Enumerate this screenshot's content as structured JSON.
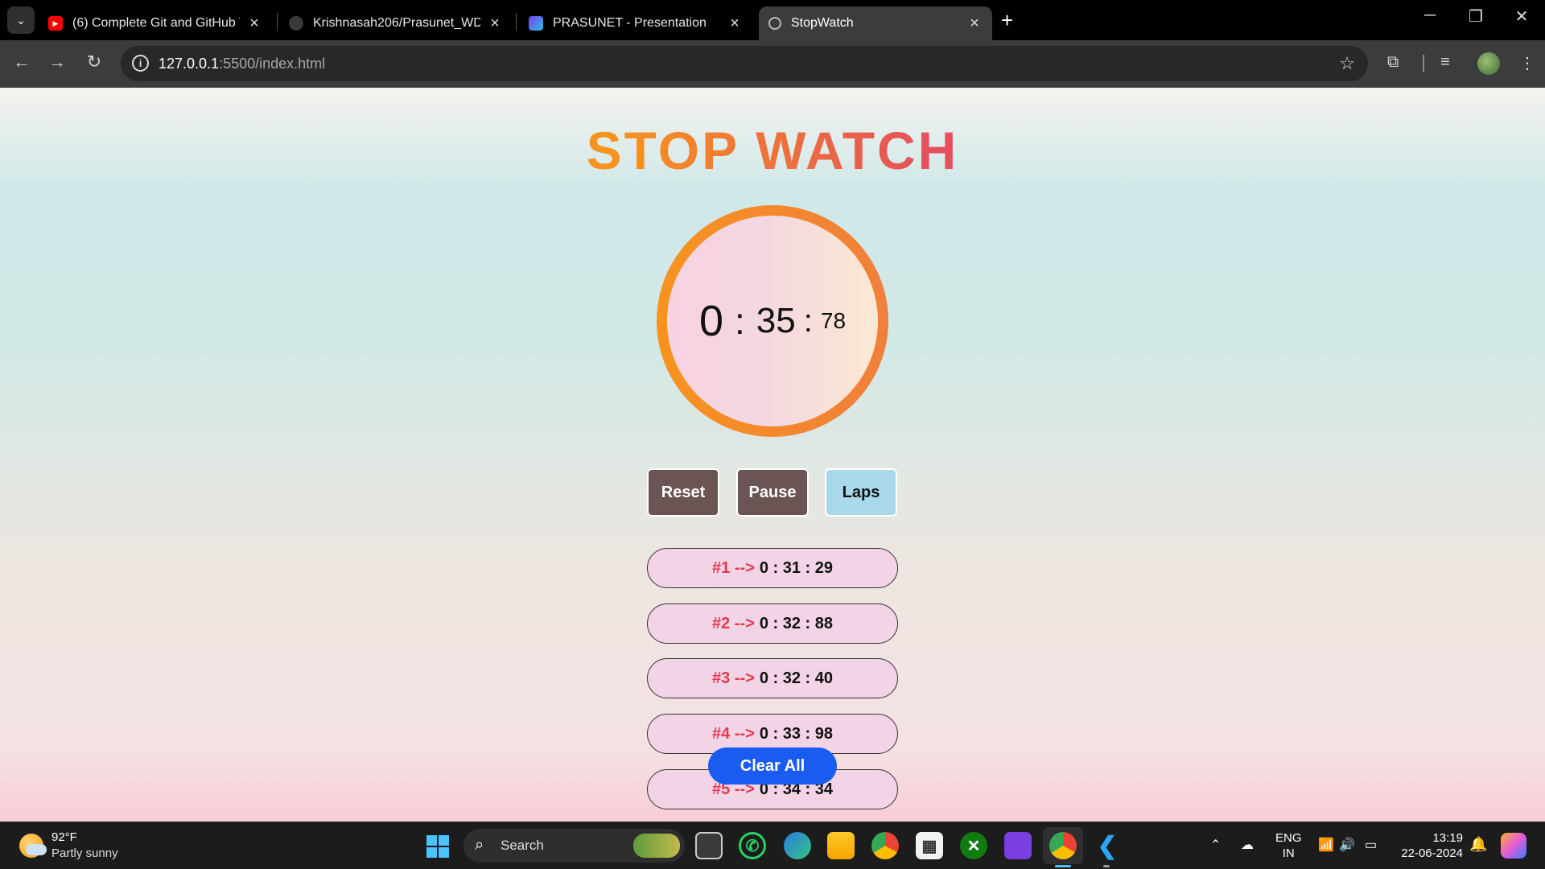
{
  "browser": {
    "tabs": [
      {
        "title": "(6) Complete Git and GitHub Tu",
        "icon": "youtube-icon"
      },
      {
        "title": "Krishnasah206/Prasunet_WD_0",
        "icon": "github-icon"
      },
      {
        "title": "PRASUNET - Presentation",
        "icon": "canva-icon"
      },
      {
        "title": "StopWatch",
        "icon": "globe-icon",
        "active": true
      }
    ],
    "url_host": "127.0.0.1",
    "url_rest": ":5500/index.html"
  },
  "app": {
    "title": "STOP WATCH",
    "time": {
      "minutes": "0",
      "sep": ":",
      "seconds": "35",
      "centiseconds": "78"
    },
    "buttons": {
      "reset": "Reset",
      "pause": "Pause",
      "laps": "Laps"
    },
    "laps": [
      {
        "index": "#1 -->",
        "time": "0 : 31 : 29"
      },
      {
        "index": "#2 -->",
        "time": "0 : 32 : 88"
      },
      {
        "index": "#3 -->",
        "time": "0 : 32 : 40"
      },
      {
        "index": "#4 -->",
        "time": "0 : 33 : 98"
      },
      {
        "index": "#5 -->",
        "time": "0 : 34 : 34"
      }
    ],
    "clear_all": "Clear All",
    "colors": {
      "title_start": "#f7931e",
      "title_end": "#e5505a",
      "ring": "#f7931e",
      "clear_button": "#1a5cf0",
      "dark_button": "#6b5454",
      "laps_button": "#a8d8ea"
    }
  },
  "taskbar": {
    "weather": {
      "temp": "92°F",
      "desc": "Partly sunny"
    },
    "search_label": "Search",
    "lang": {
      "line1": "ENG",
      "line2": "IN"
    },
    "clock": {
      "time": "13:19",
      "date": "22-06-2024"
    }
  }
}
